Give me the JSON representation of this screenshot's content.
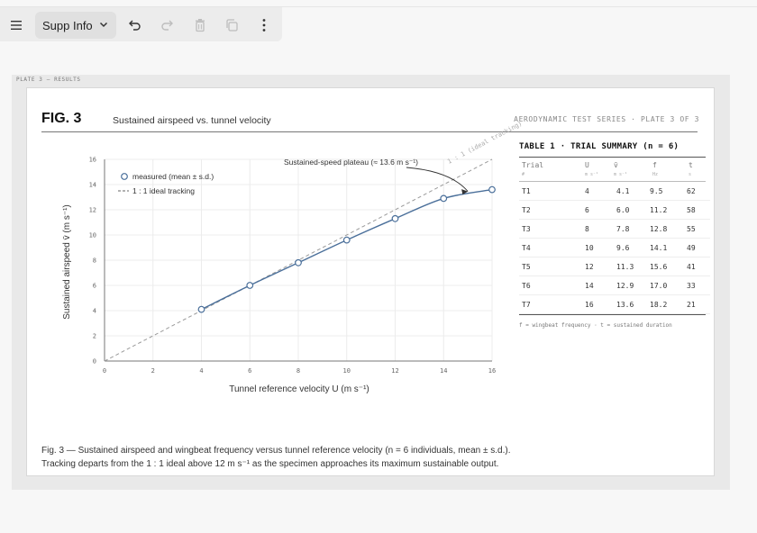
{
  "toolbar": {
    "menu_icon": "hamburger-menu-icon",
    "dropdown_label": "Supp Info",
    "undo_icon": "undo-icon",
    "redo_icon": "redo-icon",
    "delete_icon": "trash-icon",
    "duplicate_icon": "copy-icon",
    "more_icon": "more-vertical-icon"
  },
  "plate_label": "PLATE 3 — RESULTS",
  "figure": {
    "label": "FIG. 3",
    "title": "Sustained airspeed vs. tunnel velocity",
    "series_tag": "AERODYNAMIC TEST SERIES · PLATE 3 OF 3",
    "caption_line1": "Fig. 3 — Sustained airspeed and wingbeat frequency versus tunnel reference velocity (n = 6 individuals, mean ± s.d.).",
    "caption_line2": "Tracking departs from the 1 : 1 ideal above 12 m s⁻¹ as the specimen approaches its maximum sustainable output."
  },
  "chart_data": {
    "type": "line",
    "xlabel": "Tunnel reference velocity U (m s⁻¹)",
    "ylabel": "Sustained airspeed v̄ (m s⁻¹)",
    "xlim": [
      0,
      16
    ],
    "ylim": [
      0,
      16
    ],
    "xticks": [
      "0",
      "2",
      "4",
      "6",
      "8",
      "10",
      "12",
      "14",
      "16"
    ],
    "yticks": [
      "0",
      "2",
      "4",
      "6",
      "8",
      "10",
      "12",
      "14",
      "16"
    ],
    "grid": true,
    "legend_position": "top-left",
    "series": [
      {
        "name": "measured (mean ± s.d.)",
        "x": [
          4,
          6,
          8,
          10,
          12,
          14,
          16
        ],
        "y": [
          4.1,
          6.0,
          7.8,
          9.6,
          11.3,
          12.9,
          13.6
        ],
        "color": "#4a6f9a"
      },
      {
        "name": "1 : 1 ideal tracking",
        "x": [
          0,
          16
        ],
        "y": [
          0,
          16
        ],
        "style": "dashed",
        "color": "#9a9a9a"
      }
    ],
    "annotations": [
      {
        "text": "Sustained-speed plateau (≈ 13.6 m s⁻¹)",
        "target_x": 15,
        "target_y": 13.6
      },
      {
        "text": "1 : 1 (ideal tracking)"
      }
    ]
  },
  "table": {
    "title": "TABLE 1 · TRIAL SUMMARY (n = 6)",
    "columns": [
      {
        "label": "Trial",
        "unit": "#"
      },
      {
        "label": "U",
        "unit": "m s⁻¹"
      },
      {
        "label": "v̄",
        "unit": "m s⁻¹"
      },
      {
        "label": "f",
        "unit": "Hz"
      },
      {
        "label": "t",
        "unit": "s"
      }
    ],
    "rows": [
      [
        "T1",
        "4",
        "4.1",
        "9.5",
        "62"
      ],
      [
        "T2",
        "6",
        "6.0",
        "11.2",
        "58"
      ],
      [
        "T3",
        "8",
        "7.8",
        "12.8",
        "55"
      ],
      [
        "T4",
        "10",
        "9.6",
        "14.1",
        "49"
      ],
      [
        "T5",
        "12",
        "11.3",
        "15.6",
        "41"
      ],
      [
        "T6",
        "14",
        "12.9",
        "17.0",
        "33"
      ],
      [
        "T7",
        "16",
        "13.6",
        "18.2",
        "21"
      ]
    ],
    "note": "f = wingbeat frequency · t = sustained duration"
  },
  "colors": {
    "series": "#4a6f9a",
    "ideal": "#9a9a9a",
    "grid": "#ececec",
    "axis": "#777777"
  }
}
